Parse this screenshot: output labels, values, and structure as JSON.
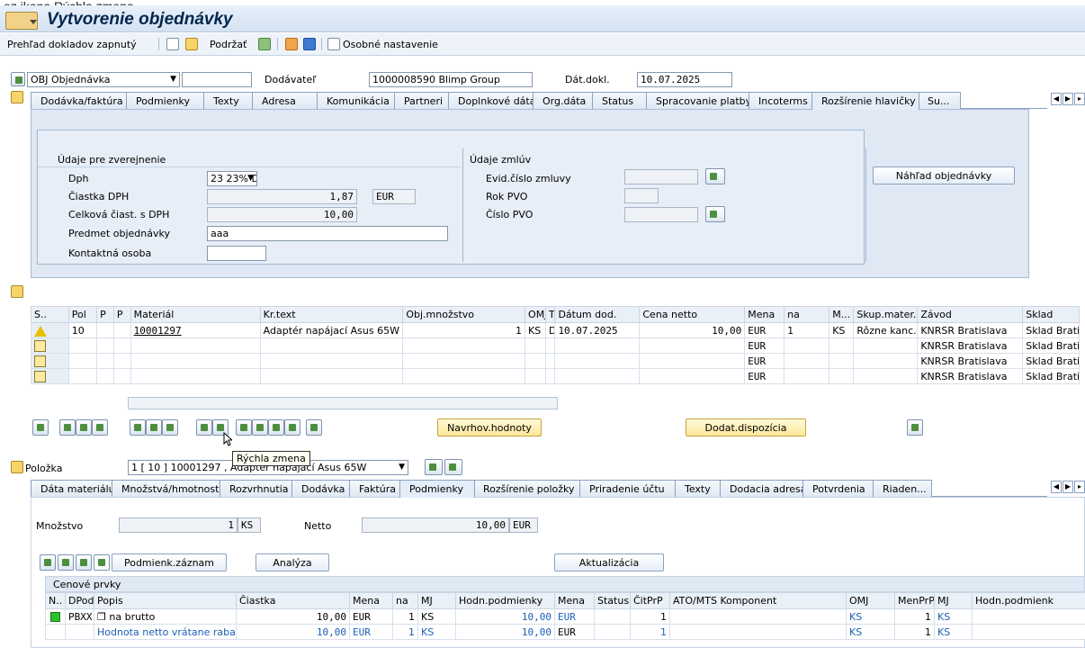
{
  "caption_fragment": "ez ikona Rýchla zmena.",
  "window": {
    "title": "Vytvorenie objednávky"
  },
  "toolbar": {
    "overview": "Prehľad dokladov zapnutý",
    "hold": "Podržať",
    "personal": "Osobné nastavenie"
  },
  "header": {
    "doc_type": "OBJ Objednávka",
    "doc_type_extra": "",
    "supplier_label": "Dodávateľ",
    "supplier_value": "1000008590 Blimp Group",
    "date_label": "Dát.dokl.",
    "date_value": "10.07.2025"
  },
  "tabs1": [
    "Dodávka/faktúra",
    "Podmienky",
    "Texty",
    "Adresa",
    "Komunikácia",
    "Partneri",
    "Doplnkové dáta",
    "Org.dáta",
    "Status",
    "Spracovanie platby",
    "Incoterms",
    "Rozšírenie hlavičky",
    "Su..."
  ],
  "tabs1_active": 11,
  "publish": {
    "title": "Údaje pre zverejnenie",
    "dph_label": "Dph",
    "dph_value": "23 23% D...",
    "ciastka_label": "Čiastka DPH",
    "ciastka_value": "1,87",
    "currency": "EUR",
    "celkova_label": "Celková čiast. s DPH",
    "celkova_value": "10,00",
    "predmet_label": "Predmet objednávky",
    "predmet_value": "aaa",
    "kontakt_label": "Kontaktná osoba",
    "kontakt_value": ""
  },
  "contract": {
    "title": "Údaje zmlúv",
    "evid_label": "Evid.číslo zmluvy",
    "rok_label": "Rok PVO",
    "cislo_label": "Číslo PVO"
  },
  "preview_button": "Náhľad objednávky",
  "items": {
    "headers": [
      "S..",
      "Pol",
      "P",
      "P",
      "Materiál",
      "Kr.text",
      "Obj.množstvo",
      "OMJ",
      "T",
      "Dátum dod.",
      "Cena netto",
      "Mena",
      "na",
      "M...",
      "Skup.mater.",
      "Závod",
      "Sklad"
    ],
    "rows": [
      [
        "",
        "10",
        "",
        "",
        "10001297",
        "Adaptér napájací Asus 65W",
        "1",
        "KS",
        "D",
        "10.07.2025",
        "10,00",
        "EUR",
        "1",
        "KS",
        "Rôzne kanc. ...",
        "KNRSR Bratislava",
        "Sklad Brati"
      ],
      [
        "",
        "",
        "",
        "",
        "",
        "",
        "",
        "",
        "",
        "",
        "",
        "EUR",
        "",
        "",
        "",
        "KNRSR Bratislava",
        "Sklad Brati"
      ],
      [
        "",
        "",
        "",
        "",
        "",
        "",
        "",
        "",
        "",
        "",
        "",
        "EUR",
        "",
        "",
        "",
        "KNRSR Bratislava",
        "Sklad Brati"
      ],
      [
        "",
        "",
        "",
        "",
        "",
        "",
        "",
        "",
        "",
        "",
        "",
        "EUR",
        "",
        "",
        "",
        "KNRSR Bratislava",
        "Sklad Brati"
      ]
    ]
  },
  "item_buttons": {
    "proposal": "Navrhov.hodnoty",
    "dispo": "Dodat.dispozícia"
  },
  "tooltip": "Rýchla zmena",
  "item_detail": {
    "label": "Položka",
    "selector": "1 [ 10 ] 10001297 , Adaptér napájací Asus 65W"
  },
  "tabs2": [
    "Dáta materiálu",
    "Množstvá/hmotnosti",
    "Rozvrhnutia",
    "Dodávka",
    "Faktúra",
    "Podmienky",
    "Rozšírenie položky",
    "Priradenie účtu",
    "Texty",
    "Dodacia adresa",
    "Potvrdenia",
    "Riaden..."
  ],
  "tabs2_active": 5,
  "conditions": {
    "mnozstvo_label": "Množstvo",
    "mnozstvo_value": "1",
    "mnozstvo_unit": "KS",
    "netto_label": "Netto",
    "netto_value": "10,00",
    "netto_currency": "EUR",
    "record_button": "Podmienk.záznam",
    "analysis_button": "Analýza",
    "update_button": "Aktualizácia",
    "section_title": "Cenové prvky",
    "headers": [
      "N..",
      "DPod",
      "Popis",
      "Čiastka",
      "Mena",
      "na",
      "MJ",
      "Hodn.podmienky",
      "Mena",
      "Status",
      "ČitPrP",
      "ATO/MTS Komponent",
      "OMJ",
      "MenPrP",
      "MJ",
      "Hodn.podmienk"
    ],
    "rows": [
      [
        "",
        "PBXX",
        "na brutto",
        "10,00",
        "EUR",
        "1",
        "KS",
        "10,00",
        "EUR",
        "",
        "1",
        "",
        "KS",
        "1",
        "KS",
        ""
      ],
      [
        "",
        "",
        "Hodnota netto vrátane raba..",
        "10,00",
        "EUR",
        "1",
        "KS",
        "10,00",
        "EUR",
        "",
        "1",
        "",
        "KS",
        "1",
        "KS",
        ""
      ]
    ]
  }
}
